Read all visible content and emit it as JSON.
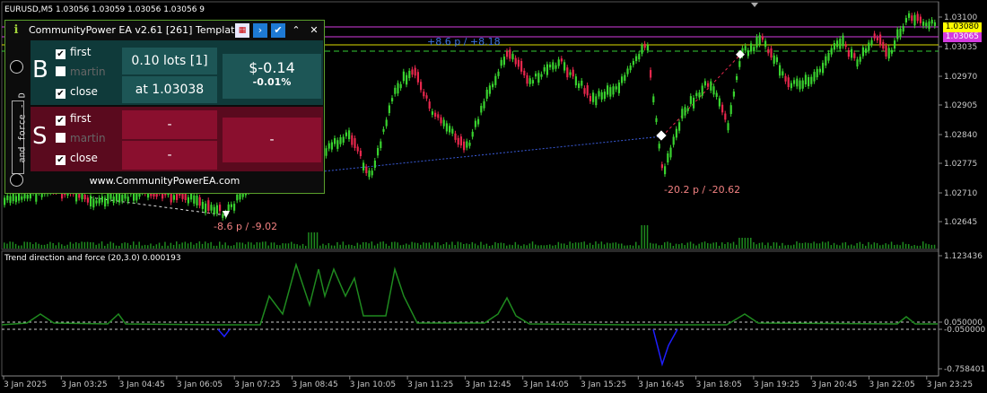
{
  "chart": {
    "symbol_line": "EURUSD,M5  1.03056 1.03059 1.03056 1.03056  9",
    "price_ticks": [
      "1.03100",
      "1.03035",
      "1.02970",
      "1.02905",
      "1.02840",
      "1.02775",
      "1.02710",
      "1.02645"
    ],
    "current_price_tag": "1.03080",
    "magenta_price_tag": "1.03065",
    "time_ticks": [
      "3 Jan 2025",
      "3 Jan 03:25",
      "3 Jan 04:45",
      "3 Jan 06:05",
      "3 Jan 07:25",
      "3 Jan 08:45",
      "3 Jan 10:05",
      "3 Jan 11:25",
      "3 Jan 12:45",
      "3 Jan 14:05",
      "3 Jan 15:25",
      "3 Jan 16:45",
      "3 Jan 18:05",
      "3 Jan 19:25",
      "3 Jan 20:45",
      "3 Jan 22:05",
      "3 Jan 23:25"
    ],
    "annotations": {
      "profit_label": "+8.6 p / +8.18",
      "loss_label_1": "-8.6 p / -9.02",
      "loss_label_2": "-20.2 p / -20.62"
    },
    "colors": {
      "bull": "#39d32f",
      "bear": "#e8274d",
      "volume": "#1f8a1f",
      "trend_up": "#1f8a1f",
      "trend_down": "#1f1fff",
      "trend_flat": "#888888",
      "magenta": "#d43be0",
      "yellow": "#ffff00"
    }
  },
  "indicator": {
    "header": "Trend direction and force (20,3.0) 0.000193",
    "ticks": [
      "1.123436",
      "0.050000",
      "-0.050000",
      "-0.758401"
    ]
  },
  "ea_panel": {
    "title": "CommunityPower EA v2.61 [261] Template",
    "side_text": "and force - D",
    "buy": {
      "letter": "B",
      "checkboxes": [
        {
          "label": "first",
          "checked": true
        },
        {
          "label": "martin",
          "checked": false
        },
        {
          "label": "close",
          "checked": true
        }
      ],
      "lots": "0.10 lots [1]",
      "price": "at 1.03038",
      "pnl": "$-0.14",
      "pnl_pct": "-0.01%"
    },
    "sell": {
      "letter": "S",
      "checkboxes": [
        {
          "label": "first",
          "checked": true
        },
        {
          "label": "martin",
          "checked": false
        },
        {
          "label": "close",
          "checked": true
        }
      ],
      "lots": "-",
      "price": "-",
      "pnl": "-"
    },
    "footer": "www.CommunityPowerEA.com"
  }
}
